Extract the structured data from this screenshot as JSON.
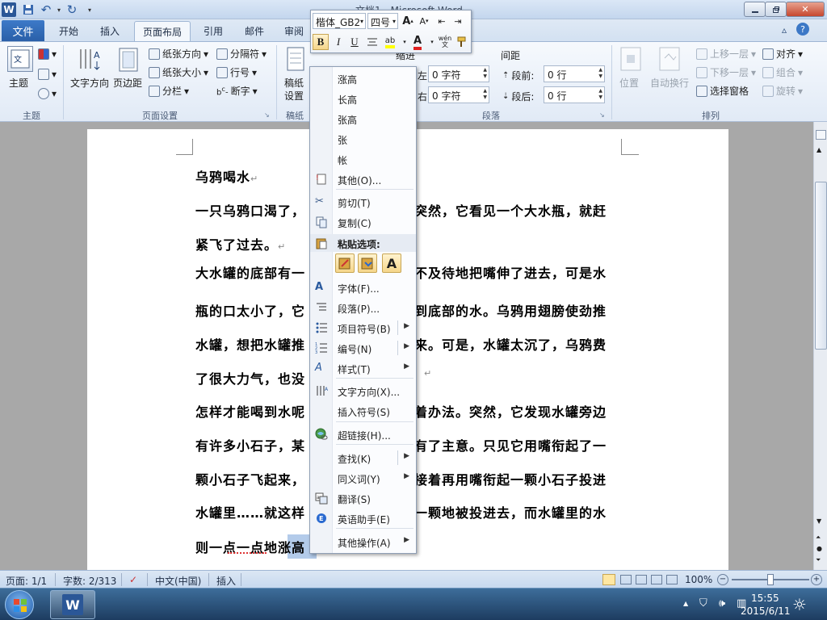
{
  "window": {
    "title": "文档1 - Microsoft Word",
    "logo": "W"
  },
  "tabs": {
    "file": "文件",
    "items": [
      "开始",
      "插入",
      "页面布局",
      "引用",
      "邮件",
      "审阅"
    ],
    "active_index": 2
  },
  "ribbon": {
    "theme": {
      "themes": "主题",
      "label": "主题"
    },
    "page_setup": {
      "text_dir": "文字方向",
      "margins": "页边距",
      "orientation": "纸张方向",
      "size": "纸张大小",
      "columns": "分栏",
      "breaks": "分隔符",
      "line_numbers": "行号",
      "hyphenation": "断字",
      "label": "页面设置"
    },
    "background": {
      "draft": "稿纸",
      "setup": "设置",
      "label": "稿纸"
    },
    "paragraph": {
      "indent": "缩进",
      "spacing": "间距",
      "left_frag": "左:",
      "right_frag": "右:",
      "left_val": "0 字符",
      "right_val": "0 字符",
      "before": "段前:",
      "after": "段后:",
      "before_val": "0 行",
      "after_val": "0 行",
      "label": "段落"
    },
    "arrange": {
      "position": "位置",
      "wrap": "自动换行",
      "forward": "上移一层",
      "backward": "下移一层",
      "pane": "选择窗格",
      "align": "对齐",
      "group": "组合",
      "rotate": "旋转",
      "label": "排列"
    }
  },
  "minitoolbar": {
    "font": "楷体_GB2",
    "size": "四号",
    "bold": "B",
    "italic": "I",
    "underline": "U",
    "phonetic": "wén\n文"
  },
  "document": {
    "lines": [
      {
        "text": "乌鸦喝水",
        "mark": "↵"
      },
      {
        "text": "一只乌鸦口渴了，",
        "tail": "突然，它看见一个大水瓶，就赶"
      },
      {
        "text": "紧飞了过去。",
        "mark": "↵"
      },
      {
        "text": "大水罐的底部有一",
        "tail": "不及待地把嘴伸了进去，可是水"
      },
      {
        "text": "瓶的口太小了，它",
        "tail": "到底部的水。乌鸦用翅膀使劲推"
      },
      {
        "text": "水罐，想把水罐推",
        "tail": "来。可是，水罐太沉了，乌鸦费"
      },
      {
        "text": "了很大力气，也没",
        "tail": "↵"
      },
      {
        "text": "怎样才能喝到水呢",
        "tail": "着办法。突然，它发现水罐旁边"
      },
      {
        "text": "有许多小石子，某",
        "tail": "有了主意。只见它用嘴衔起了一"
      },
      {
        "text": "颗小石子飞起来，",
        "tail": "接着再用嘴衔起一颗小石子投进"
      },
      {
        "text": "水罐里……就这样",
        "tail": "一颗地被投进去，而水罐里的水"
      },
      {
        "text": "则一点一点地",
        "sel": "涨高"
      }
    ]
  },
  "context_menu": {
    "suggestions": [
      "涨高",
      "长高",
      "张高",
      "张",
      "帐"
    ],
    "items": {
      "other": "其他(O)...",
      "cut": "剪切(T)",
      "copy": "复制(C)",
      "paste_header": "粘贴选项:",
      "font": "字体(F)...",
      "paragraph": "段落(P)...",
      "bullets": "项目符号(B)",
      "numbering": "编号(N)",
      "styles": "样式(T)",
      "text_direction": "文字方向(X)...",
      "insert_symbol": "插入符号(S)",
      "hyperlink": "超链接(H)...",
      "find": "查找(K)",
      "synonyms": "同义词(Y)",
      "translate": "翻译(S)",
      "english_assistant": "英语助手(E)",
      "more_actions": "其他操作(A)"
    },
    "paste_keep_text": "A"
  },
  "statusbar": {
    "page": "页面: 1/1",
    "words": "字数: 2/313",
    "language": "中文(中国)",
    "mode": "插入",
    "zoom": "100%"
  },
  "taskbar": {
    "time": "15:55",
    "date": "2015/6/11"
  }
}
